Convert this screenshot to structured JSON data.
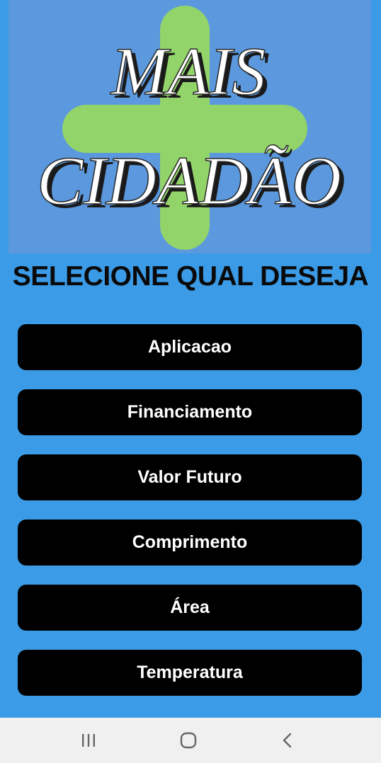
{
  "logo": {
    "line1": "MAIS",
    "line2": "CIDADÃO",
    "background_color": "#5b98dd",
    "plus_color": "#93d46a",
    "icon": "plus-icon"
  },
  "prompt": {
    "text": "SELECIONE QUAL DESEJA"
  },
  "menu": {
    "items": [
      {
        "label": "Aplicacao"
      },
      {
        "label": "Financiamento"
      },
      {
        "label": "Valor Futuro"
      },
      {
        "label": "Comprimento"
      },
      {
        "label": "Área"
      },
      {
        "label": "Temperatura"
      }
    ]
  },
  "navbar": {
    "recents_icon": "recents-icon",
    "home_icon": "home-icon",
    "back_icon": "back-icon"
  },
  "colors": {
    "screen_background": "#3b9be6",
    "button_background": "#000000",
    "button_text": "#ffffff",
    "navbar_background": "#f0f0f0"
  }
}
